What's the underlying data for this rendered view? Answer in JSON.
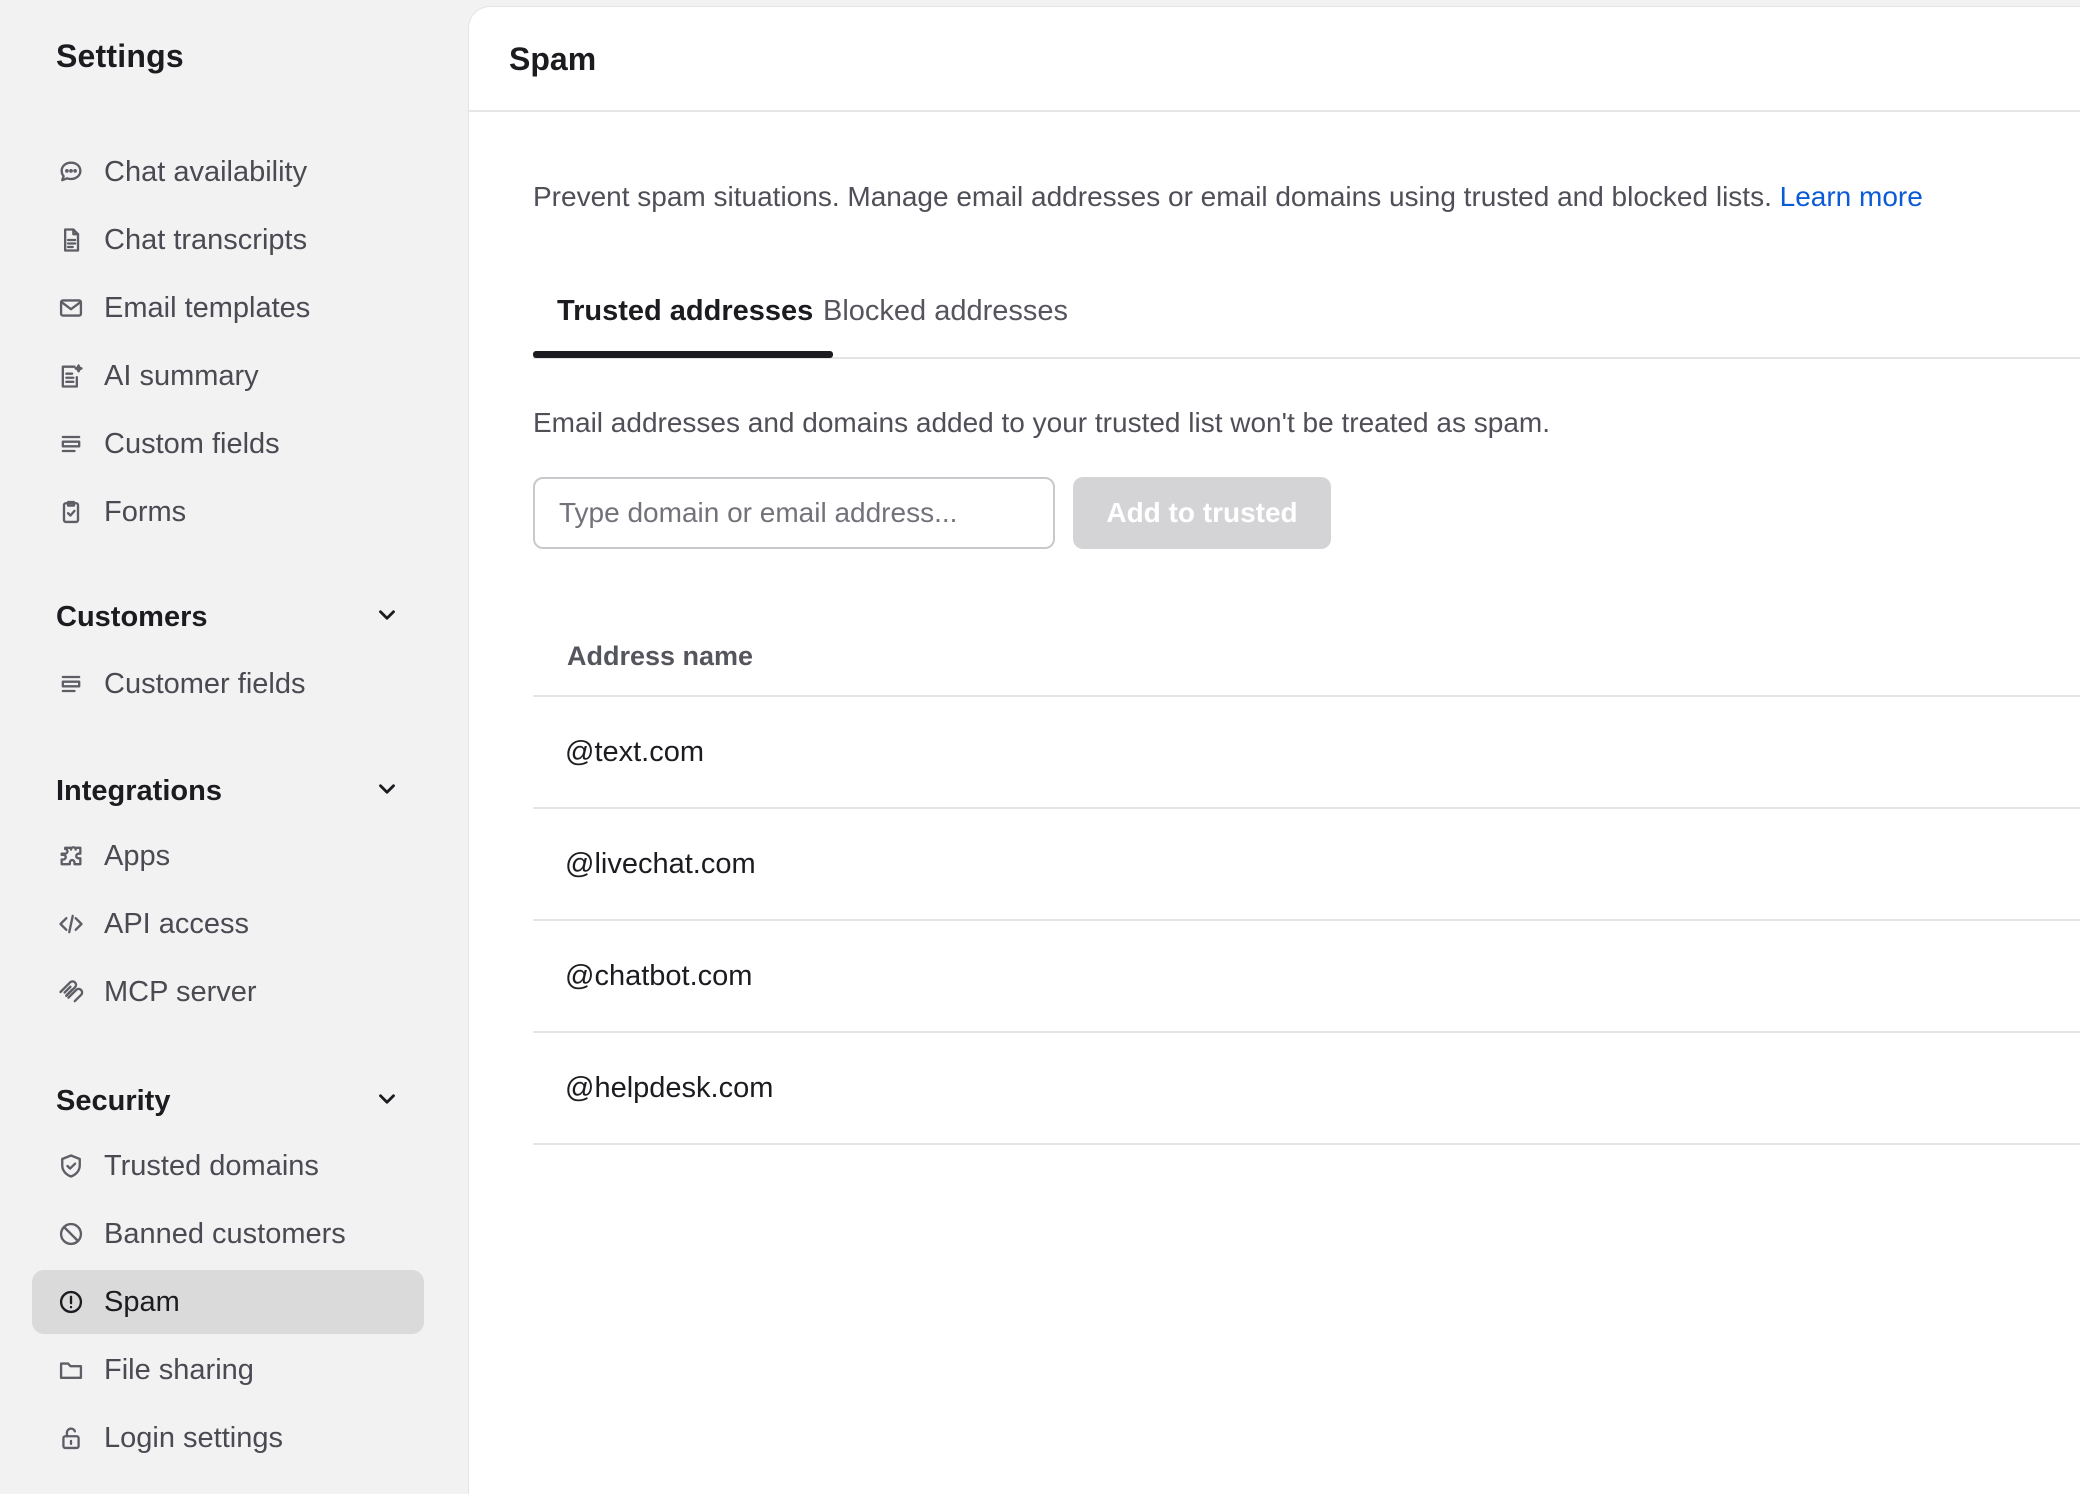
{
  "sidebar": {
    "title": "Settings",
    "items_top": [
      {
        "label": "Chat availability",
        "icon": "chat-bubble-icon"
      },
      {
        "label": "Chat transcripts",
        "icon": "document-icon"
      },
      {
        "label": "Email templates",
        "icon": "envelope-icon"
      },
      {
        "label": "AI summary",
        "icon": "ai-document-icon"
      },
      {
        "label": "Custom fields",
        "icon": "fields-icon"
      },
      {
        "label": "Forms",
        "icon": "clipboard-check-icon"
      }
    ],
    "sections": [
      {
        "label": "Customers",
        "items": [
          {
            "label": "Customer fields",
            "icon": "fields-icon"
          }
        ]
      },
      {
        "label": "Integrations",
        "items": [
          {
            "label": "Apps",
            "icon": "puzzle-icon"
          },
          {
            "label": "API access",
            "icon": "code-icon"
          },
          {
            "label": "MCP server",
            "icon": "mcp-icon"
          }
        ]
      },
      {
        "label": "Security",
        "items": [
          {
            "label": "Trusted domains",
            "icon": "shield-check-icon"
          },
          {
            "label": "Banned customers",
            "icon": "ban-icon"
          },
          {
            "label": "Spam",
            "icon": "alert-circle-icon",
            "active": true
          },
          {
            "label": "File sharing",
            "icon": "folder-icon"
          },
          {
            "label": "Login settings",
            "icon": "lock-icon"
          }
        ]
      }
    ]
  },
  "main": {
    "title": "Spam",
    "description": "Prevent spam situations. Manage email addresses or email domains using trusted and blocked lists.",
    "learn_more": "Learn more",
    "tabs": [
      {
        "label": "Trusted addresses",
        "active": true
      },
      {
        "label": "Blocked addresses",
        "active": false
      }
    ],
    "tab_description": "Email addresses and domains added to your trusted list won't be treated as spam.",
    "input_placeholder": "Type domain or email address...",
    "add_button": "Add to trusted",
    "table": {
      "column_header": "Address name",
      "rows": [
        "@text.com",
        "@livechat.com",
        "@chatbot.com",
        "@helpdesk.com"
      ]
    }
  },
  "colors": {
    "accent_link": "#0b5bd7",
    "active_nav_bg": "#dadada",
    "sidebar_bg": "#f2f2f2",
    "disabled_button_bg": "#d4d4d6"
  }
}
